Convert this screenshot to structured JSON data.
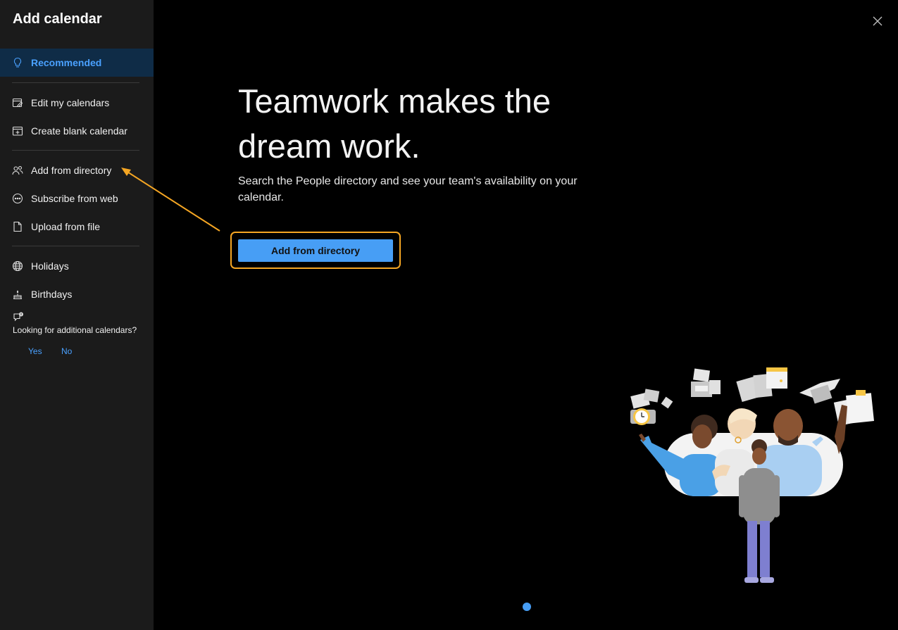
{
  "sidebar": {
    "title": "Add calendar",
    "items": [
      {
        "label": "Recommended",
        "icon": "lightbulb-icon",
        "selected": true
      },
      {
        "label": "Edit my calendars",
        "icon": "edit-calendar-icon"
      },
      {
        "label": "Create blank calendar",
        "icon": "add-calendar-icon"
      },
      {
        "label": "Add from directory",
        "icon": "people-icon"
      },
      {
        "label": "Subscribe from web",
        "icon": "link-icon"
      },
      {
        "label": "Upload from file",
        "icon": "document-icon"
      },
      {
        "label": "Holidays",
        "icon": "globe-icon"
      },
      {
        "label": "Birthdays",
        "icon": "cake-icon"
      }
    ],
    "feedback": {
      "icon": "feedback-icon",
      "text": "Looking for additional calendars?",
      "yes": "Yes",
      "no": "No"
    }
  },
  "main": {
    "headline": "Teamwork makes the dream work.",
    "description": "Search the People directory and see your team's availability on your calendar.",
    "primary_button": "Add from directory",
    "close_icon": "close-icon",
    "pager_count": 1,
    "pager_active": 1
  },
  "colors": {
    "accent": "#479ef5",
    "highlight": "#f5a623",
    "selected_bg": "#0f2c47",
    "sidebar_bg": "#1b1b1b"
  }
}
